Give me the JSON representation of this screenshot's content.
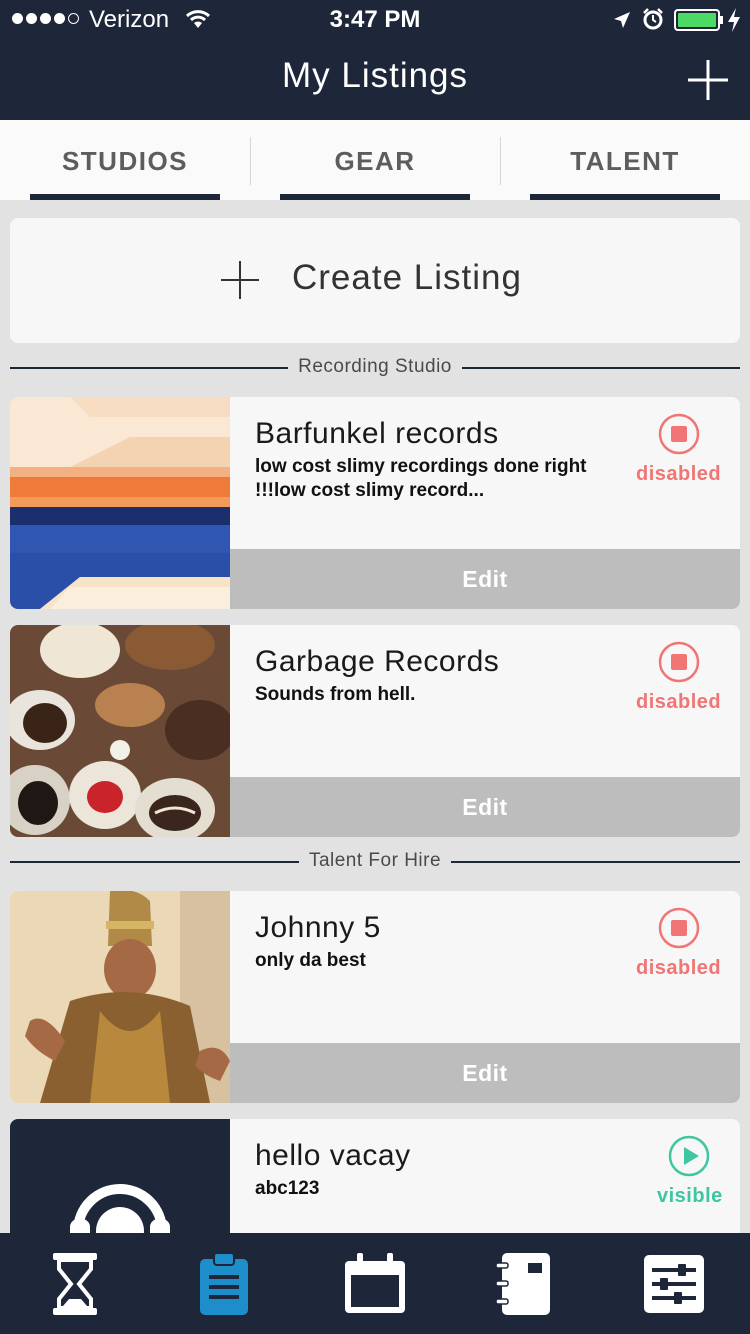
{
  "status_bar": {
    "carrier": "Verizon",
    "time": "3:47 PM"
  },
  "nav": {
    "title": "My Listings"
  },
  "tabs": [
    {
      "label": "STUDIOS"
    },
    {
      "label": "GEAR"
    },
    {
      "label": "TALENT"
    }
  ],
  "create": {
    "label": "Create Listing"
  },
  "sections": [
    {
      "title": "Recording Studio"
    },
    {
      "title": "Talent For Hire"
    }
  ],
  "listings": [
    {
      "title": "Barfunkel records",
      "description": "low cost slimy recordings done right !!!low cost slimy record...",
      "status": "disabled",
      "edit_label": "Edit"
    },
    {
      "title": "Garbage Records",
      "description": "Sounds from hell.",
      "status": "disabled",
      "edit_label": "Edit"
    },
    {
      "title": "Johnny 5",
      "description": "only da best",
      "status": "disabled",
      "edit_label": "Edit"
    },
    {
      "title": "hello vacay",
      "description": "abc123",
      "status": "visible"
    }
  ],
  "bottom_nav": [
    {
      "icon": "hourglass-icon"
    },
    {
      "icon": "clipboard-icon",
      "active": true
    },
    {
      "icon": "calendar-icon"
    },
    {
      "icon": "notebook-icon"
    },
    {
      "icon": "sliders-icon"
    }
  ],
  "colors": {
    "navy": "#1e263a",
    "disabled": "#f07574",
    "visible": "#3fc6a1",
    "active_tab_icon": "#1e8ecb",
    "edit_bar": "#bdbdbd"
  }
}
